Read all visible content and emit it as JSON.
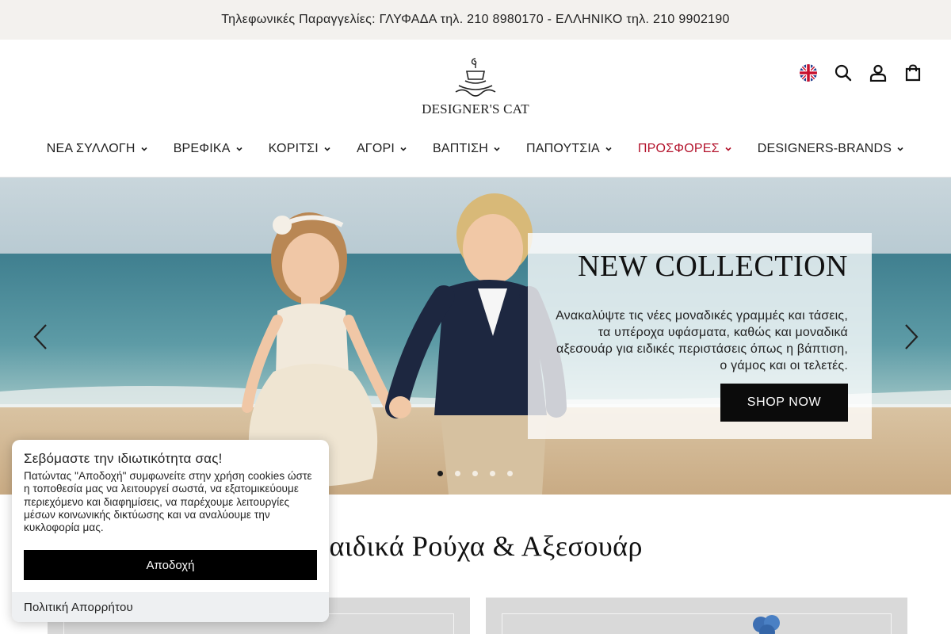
{
  "topbar": {
    "text": "Τηλεφωνικές Παραγγελίες: ΓΛΥΦΑΔΑ τηλ. 210 8980170 - ΕΛΛΗΝΙΚΟ τηλ. 210 9902190"
  },
  "header": {
    "logo_text": "DESIGNER'S CAT",
    "icons": [
      "uk-flag-icon",
      "search-icon",
      "account-icon",
      "cart-icon"
    ]
  },
  "nav": {
    "items": [
      {
        "label": "ΝΕΑ ΣΥΛΛΟΓΗ"
      },
      {
        "label": "ΒΡΕΦΙΚΑ"
      },
      {
        "label": "ΚΟΡΙΤΣΙ"
      },
      {
        "label": "ΑΓΟΡΙ"
      },
      {
        "label": "ΒΑΠΤΙΣΗ"
      },
      {
        "label": "ΠΑΠΟΥΤΣΙΑ"
      },
      {
        "label": "ΠΡΟΣΦΟΡΕΣ"
      },
      {
        "label": "DESIGNERS-BRANDS"
      }
    ],
    "sale_color": "#b3122b"
  },
  "hero": {
    "title": "NEW COLLECTION",
    "text": "Ανακαλύψτε τις νέες μοναδικές γραμμές και τάσεις, τα υπέροχα υφάσματα, καθώς και μοναδικά αξεσουάρ για ειδικές περιστάσεις όπως η βάπτιση, ο γάμος και οι τελετές.",
    "button": "SHOP NOW",
    "slides": 5,
    "active_slide": 1
  },
  "section": {
    "title": "Παιδικά Ρούχα & Αξεσουάρ"
  },
  "cookie": {
    "title": "Σεβόμαστε την ιδιωτικότητα σας!",
    "text": "Πατώντας \"Αποδοχή\" συμφωνείτε στην χρήση cookies ώστε η τοποθεσία μας να λειτουργεί σωστά, να εξατομικεύουμε περιεχόμενο και διαφημίσεις, να παρέχουμε λειτουργίες μέσων κοινωνικής δικτύωσης και να αναλύουμε την κυκλοφορία μας.",
    "accept": "Αποδοχή",
    "policy": "Πολιτική Απορρήτου"
  }
}
